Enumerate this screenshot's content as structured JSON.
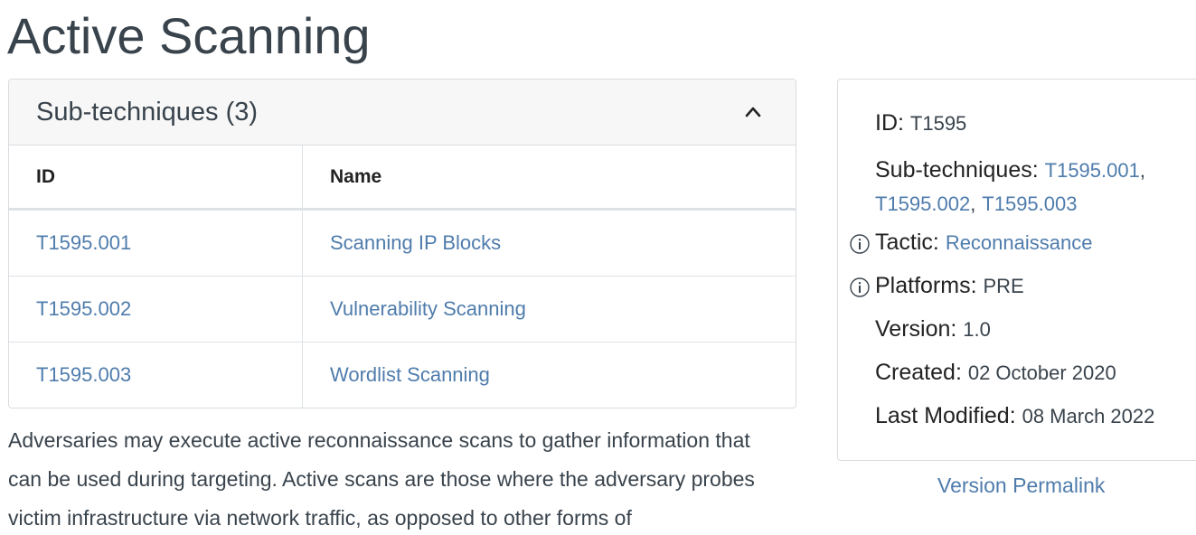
{
  "page": {
    "title": "Active Scanning"
  },
  "subtechniques": {
    "header": "Sub-techniques (3)",
    "columns": [
      "ID",
      "Name"
    ],
    "rows": [
      {
        "id": "T1595.001",
        "name": "Scanning IP Blocks"
      },
      {
        "id": "T1595.002",
        "name": "Vulnerability Scanning"
      },
      {
        "id": "T1595.003",
        "name": "Wordlist Scanning"
      }
    ]
  },
  "description": {
    "line1": "Adversaries may execute active reconnaissance scans to gather information that",
    "line2": "can be used during targeting. Active scans are those where the adversary probes",
    "line3": "victim infrastructure via network traffic, as opposed to other forms of"
  },
  "info": {
    "id_label": "ID:",
    "id_value": "T1595",
    "subtech_label": "Sub-techniques:",
    "subtech_links": [
      "T1595.001",
      "T1595.002",
      "T1595.003"
    ],
    "sep": ",",
    "tactic_label": "Tactic:",
    "tactic_value": "Reconnaissance",
    "platforms_label": "Platforms:",
    "platforms_value": "PRE",
    "version_label": "Version:",
    "version_value": "1.0",
    "created_label": "Created:",
    "created_value": "02 October 2020",
    "modified_label": "Last Modified:",
    "modified_value": "08 March 2022"
  },
  "permalink": {
    "label": "Version Permalink"
  },
  "colors": {
    "link": "#4f7cac",
    "text": "#39434c",
    "border": "#d9dcdf",
    "header_bg": "#f7f7f7"
  },
  "icons": {
    "collapse": "chevron-up-icon",
    "info": "info-circle-icon"
  }
}
